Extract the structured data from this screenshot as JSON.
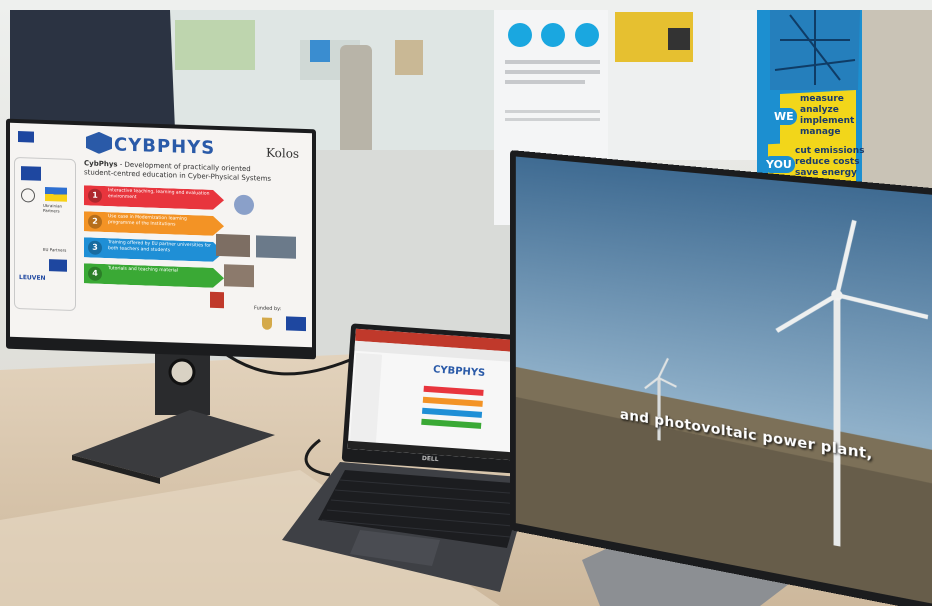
{
  "left_monitor": {
    "logo_text": "CYBPHYS",
    "partner_logo": "Kolos",
    "headline_brand": "CybPhys",
    "headline_rest": " - Development of practically oriented",
    "subheadline": "student-centred education in Cyber-Physical Systems",
    "steps": [
      {
        "number": "1",
        "text": "Interactive teaching, learning and evaluation environment",
        "color": "#e8353d"
      },
      {
        "number": "2",
        "text": "Use case in Modernization learning programme of the Institutions",
        "color": "#f39325"
      },
      {
        "number": "3",
        "text": "Training offered by EU partner universities for both teachers and students",
        "color": "#1f8fd6"
      },
      {
        "number": "4",
        "text": "Tutorials and teaching material",
        "color": "#3aa935"
      }
    ],
    "side_labels": [
      "Ukrainian Partners",
      "EU Partners",
      "LEUVEN"
    ],
    "funded_label": "Funded by:"
  },
  "laptop": {
    "brand": "DELL",
    "screen_logo": "CYBPHYS"
  },
  "right_monitor": {
    "subtitle": "and photovoltaic power plant,"
  },
  "poster": {
    "lines": [
      "measure",
      "analyze",
      "implement",
      "manage",
      "cut emissions",
      "reduce costs",
      "save energy"
    ],
    "bubbles": [
      "WE",
      "YOU"
    ]
  },
  "colors": {
    "bezel": "#1b1c1e",
    "desk": "#d8c6ae",
    "poster_blue": "#1c8fd0",
    "poster_yellow": "#f2d61a"
  }
}
